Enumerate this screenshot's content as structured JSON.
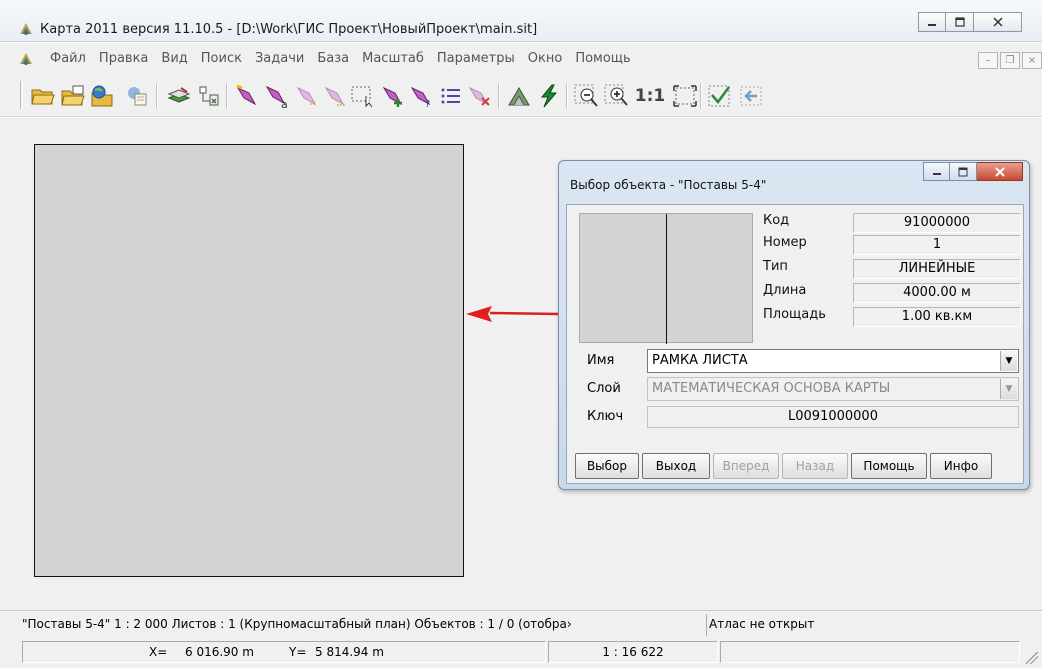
{
  "window": {
    "title": "Карта 2011 версия 11.10.5 - [D:\\Work\\ГИС Проект\\НовыйПроект\\main.sit]"
  },
  "menu": {
    "items": [
      "Файл",
      "Правка",
      "Вид",
      "Поиск",
      "Задачи",
      "База",
      "Масштаб",
      "Параметры",
      "Окно",
      "Помощь"
    ]
  },
  "toolbar": {
    "scale_1to1_label": "1:1"
  },
  "dialog": {
    "title": "Выбор объекта - \"Поставы 5-4\"",
    "properties": [
      {
        "label": "Код",
        "value": "91000000"
      },
      {
        "label": "Номер",
        "value": "1"
      },
      {
        "label": "Тип",
        "value": "ЛИНЕЙНЫЕ"
      },
      {
        "label": "Длина",
        "value": "4000.00  м"
      },
      {
        "label": "Площадь",
        "value": "1.00  кв.км"
      }
    ],
    "name_label": "Имя",
    "name_value": "РАМКА ЛИСТА",
    "layer_label": "Слой",
    "layer_value": "МАТЕМАТИЧЕСКАЯ ОСНОВА КАРТЫ",
    "key_label": "Ключ",
    "key_value": "L0091000000",
    "buttons": {
      "select": "Выбор",
      "exit": "Выход",
      "forward": "Вперед",
      "back": "Назад",
      "help": "Помощь",
      "info": "Инфо"
    }
  },
  "statusbar": {
    "main_text": "\"Поставы 5-4\"  1 : 2 000   Листов : 1   (Крупномасштабный план)  Объектов : 1 / 0 (отобра›",
    "atlas_text": "Атлас не открыт",
    "x_label": "X=",
    "x_value": "6 016.90 m",
    "y_label": "Y=",
    "y_value": "5 814.94 m",
    "scale": "1 : 16 622"
  }
}
